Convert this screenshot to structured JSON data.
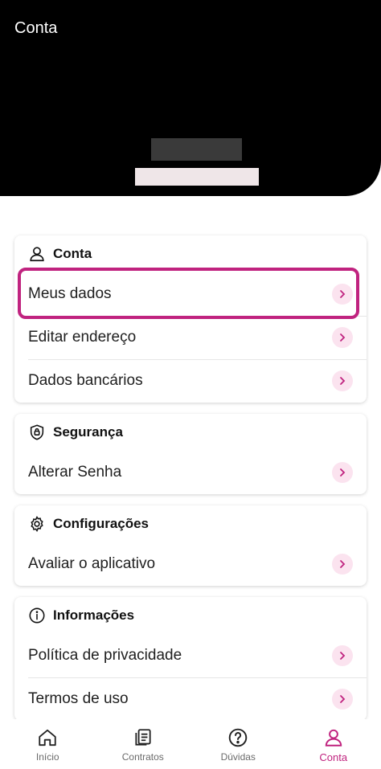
{
  "header": {
    "title": "Conta"
  },
  "accent": "#c0237f",
  "sections": {
    "conta": {
      "title": "Conta",
      "icon": "person-icon",
      "items": [
        "Meus dados",
        "Editar endereço",
        "Dados bancários"
      ]
    },
    "seguranca": {
      "title": "Segurança",
      "icon": "shield-lock-icon",
      "items": [
        "Alterar Senha"
      ]
    },
    "config": {
      "title": "Configurações",
      "icon": "gear-icon",
      "items": [
        "Avaliar o aplicativo"
      ]
    },
    "info": {
      "title": "Informações",
      "icon": "info-icon",
      "items": [
        "Política de privacidade",
        "Termos de uso"
      ]
    }
  },
  "tabs": [
    "Início",
    "Contratos",
    "Dúvidas",
    "Conta"
  ]
}
